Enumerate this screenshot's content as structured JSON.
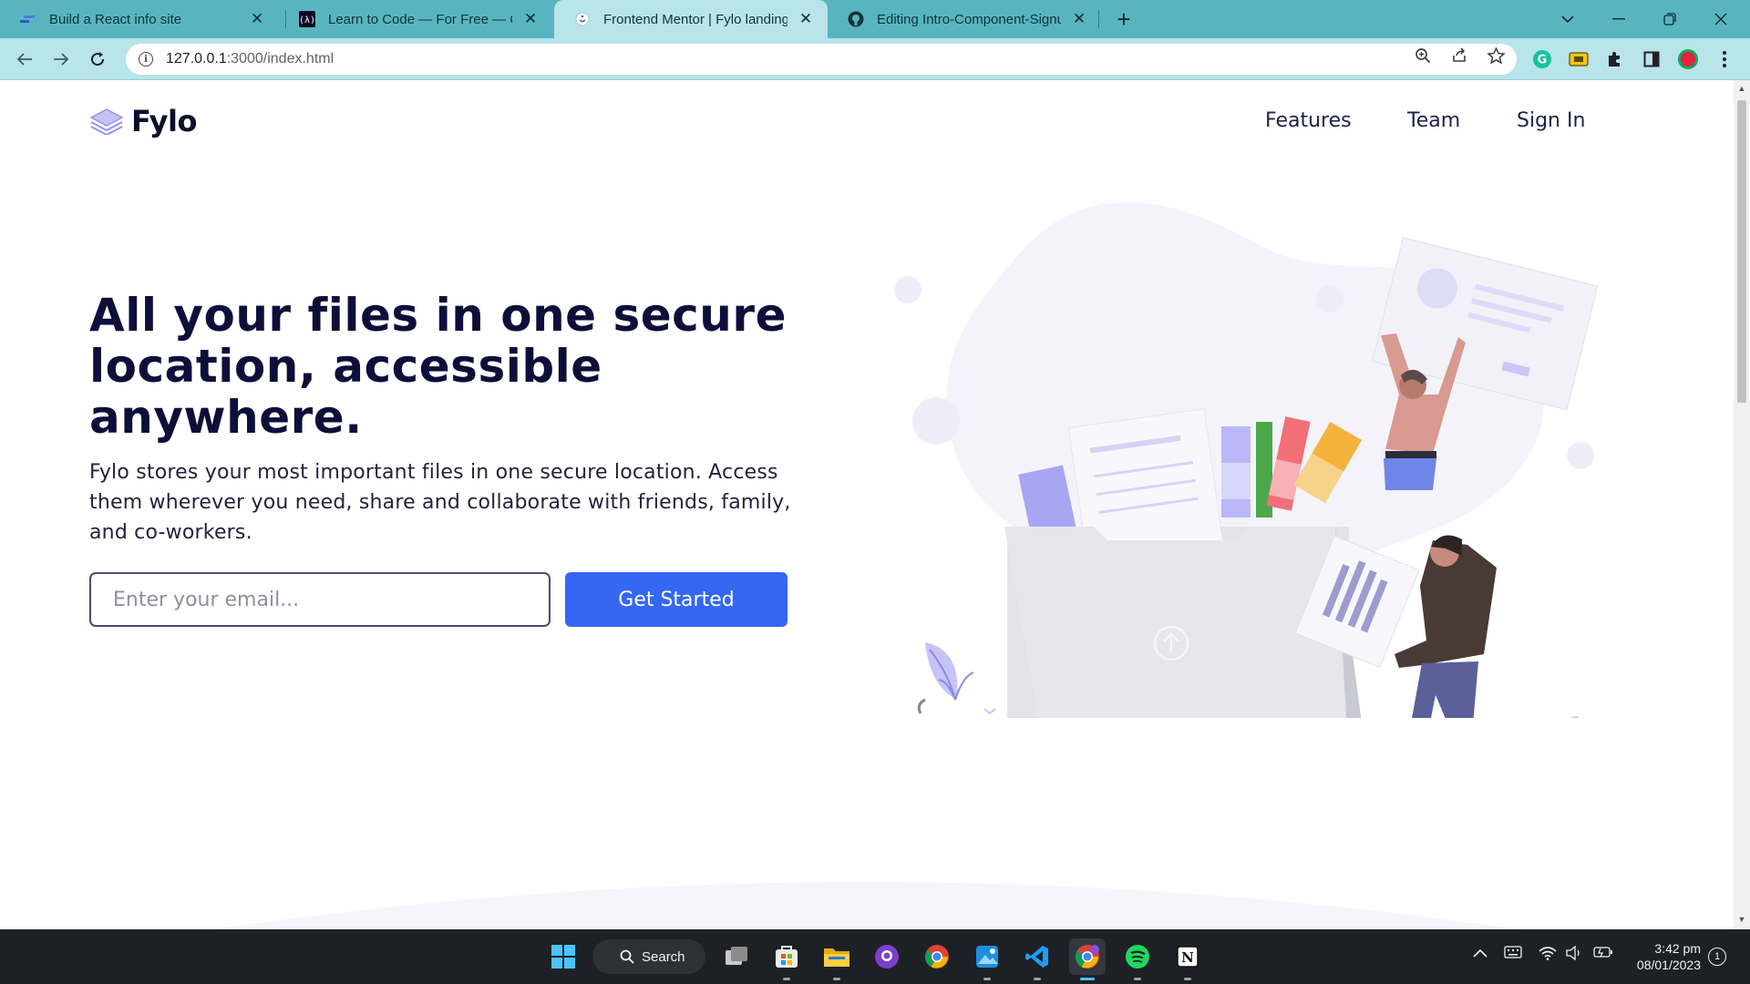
{
  "browser": {
    "tabs": [
      {
        "title": "Build a React info site",
        "favicon": "scrimba-icon",
        "active": false
      },
      {
        "title": "Learn to Code — For Free — Coding",
        "favicon": "freecodecamp-icon",
        "active": false
      },
      {
        "title": "Frontend Mentor | Fylo landing page",
        "favicon": "frontend-mentor-icon",
        "active": true
      },
      {
        "title": "Editing Intro-Component-Signup",
        "favicon": "github-icon",
        "active": false
      }
    ],
    "new_tab": "+",
    "address": {
      "host": "127.0.0.1",
      "rest": ":3000/index.html"
    }
  },
  "page": {
    "logo": {
      "text": "Fylo"
    },
    "nav": [
      {
        "label": "Features"
      },
      {
        "label": "Team"
      },
      {
        "label": "Sign In"
      }
    ],
    "hero": {
      "title": "All your files in one secure location, accessible anywhere.",
      "text": "Fylo stores your most important files in one secure location. Access them wherever you need, share and collaborate with friends, family, and co-workers.",
      "email_placeholder": "Enter your email...",
      "cta_label": "Get Started"
    }
  },
  "taskbar": {
    "search_label": "Search",
    "clock": {
      "time": "3:42 pm",
      "date": "08/01/2023"
    },
    "notifications": "1",
    "apps": [
      "start-icon",
      "task-view-icon",
      "microsoft-store-icon",
      "file-explorer-icon",
      "github-desktop-icon",
      "chrome-icon",
      "photos-icon",
      "vscode-icon",
      "chrome-profile-icon",
      "spotify-icon",
      "notion-icon"
    ]
  },
  "colors": {
    "tabbar": "#58b5c0",
    "toolbar": "#b8e4ea",
    "heading": "#0e0e3a",
    "cta": "#3567f3",
    "illustration_accent": "#a5a2f4"
  }
}
